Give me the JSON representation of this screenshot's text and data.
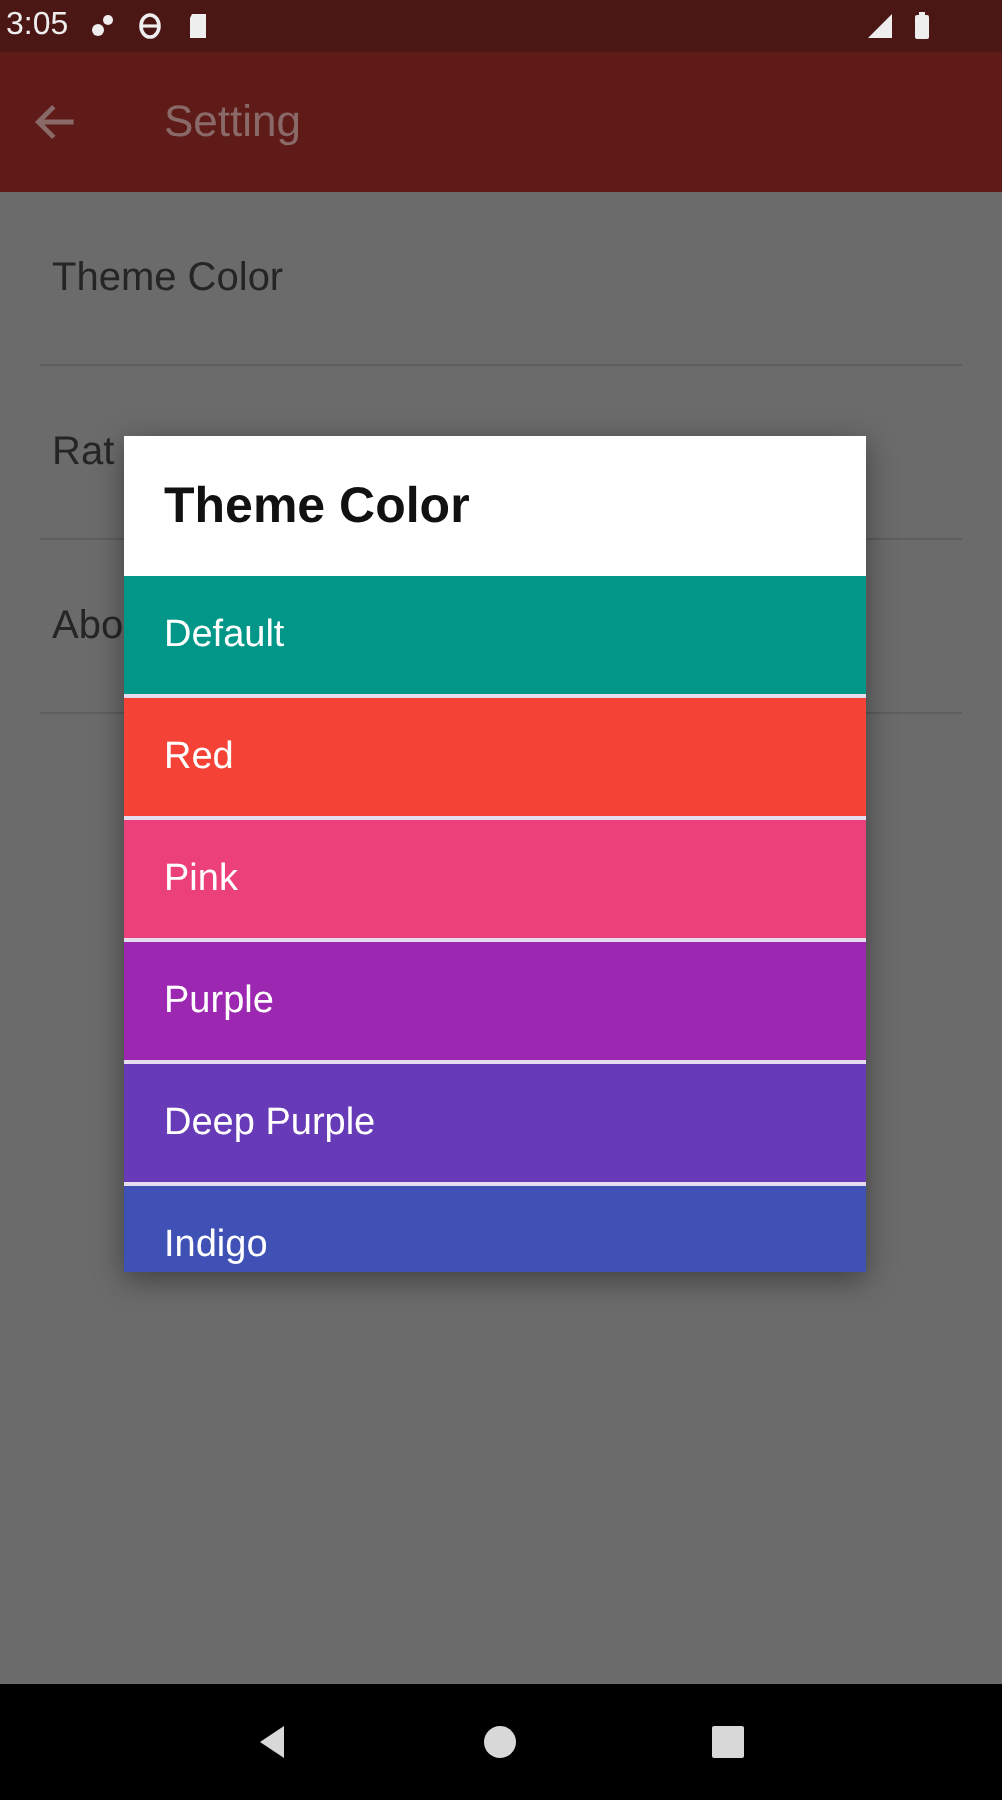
{
  "status_bar": {
    "time": "3:05"
  },
  "app_bar": {
    "title": "Setting"
  },
  "settings": [
    {
      "label": "Theme Color"
    },
    {
      "label": "Rat"
    },
    {
      "label": "Abo"
    }
  ],
  "dialog": {
    "title": "Theme Color",
    "options": [
      {
        "label": "Default",
        "color": "#009688"
      },
      {
        "label": "Red",
        "color": "#f44336"
      },
      {
        "label": "Pink",
        "color": "#ec407a"
      },
      {
        "label": "Purple",
        "color": "#9c27b0"
      },
      {
        "label": "Deep Purple",
        "color": "#673ab7"
      },
      {
        "label": "Indigo",
        "color": "#3f51b5"
      }
    ]
  }
}
